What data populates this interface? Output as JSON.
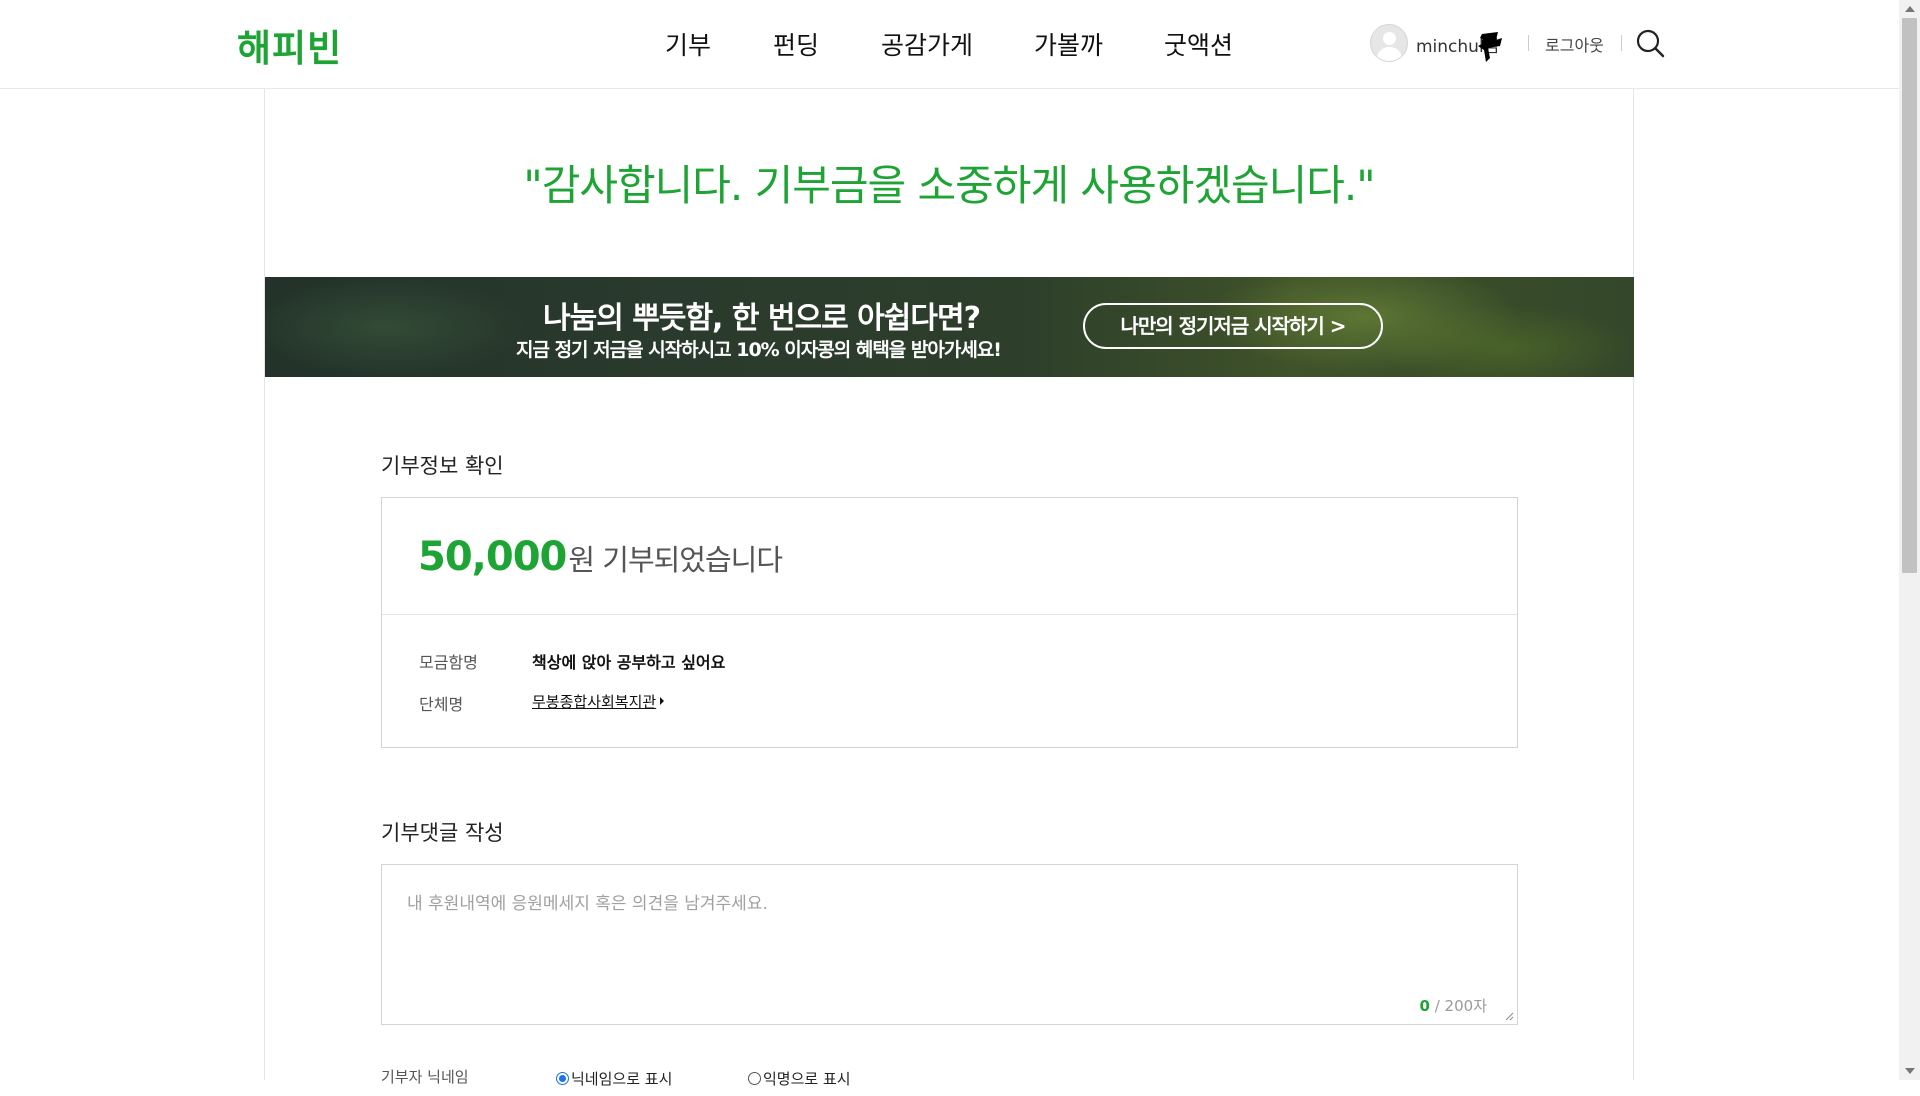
{
  "header": {
    "logo": "해피빈",
    "nav": [
      {
        "label": "기부"
      },
      {
        "label": "펀딩"
      },
      {
        "label": "공감가게"
      },
      {
        "label": "가볼까"
      },
      {
        "label": "굿액션"
      }
    ],
    "user": {
      "name": "minchul님",
      "avatar_icon": "user-avatar-icon"
    },
    "logout_label": "로그아웃",
    "search_icon": "search-icon"
  },
  "thanks_message": "\"감사합니다. 기부금을 소중하게 사용하겠습니다.\"",
  "banner": {
    "title": "나눔의 뿌듯함, 한 번으로 아쉽다면?",
    "subtitle": "지금 정기 저금을 시작하시고 10% 이자콩의 혜택을 받아가세요!",
    "button_label": "나만의 정기저금 시작하기 >"
  },
  "donation_info": {
    "section_title": "기부정보 확인",
    "amount": "50,000",
    "amount_suffix": "원 기부되었습니다",
    "fundraiser_label": "모금함명",
    "fundraiser_value": "책상에 앉아 공부하고 싶어요",
    "org_label": "단체명",
    "org_value": "무봉종합사회복지관"
  },
  "comment": {
    "section_title": "기부댓글 작성",
    "placeholder": "내 후원내역에 응원메세지 혹은 의견을 남겨주세요.",
    "count_current": "0",
    "count_max": " / 200자"
  },
  "nickname": {
    "label": "기부자 닉네임",
    "options": [
      {
        "label": "닉네임으로 표시",
        "selected": true
      },
      {
        "label": "익명으로 표시",
        "selected": false
      }
    ]
  },
  "colors": {
    "brand": "#1ea434"
  }
}
